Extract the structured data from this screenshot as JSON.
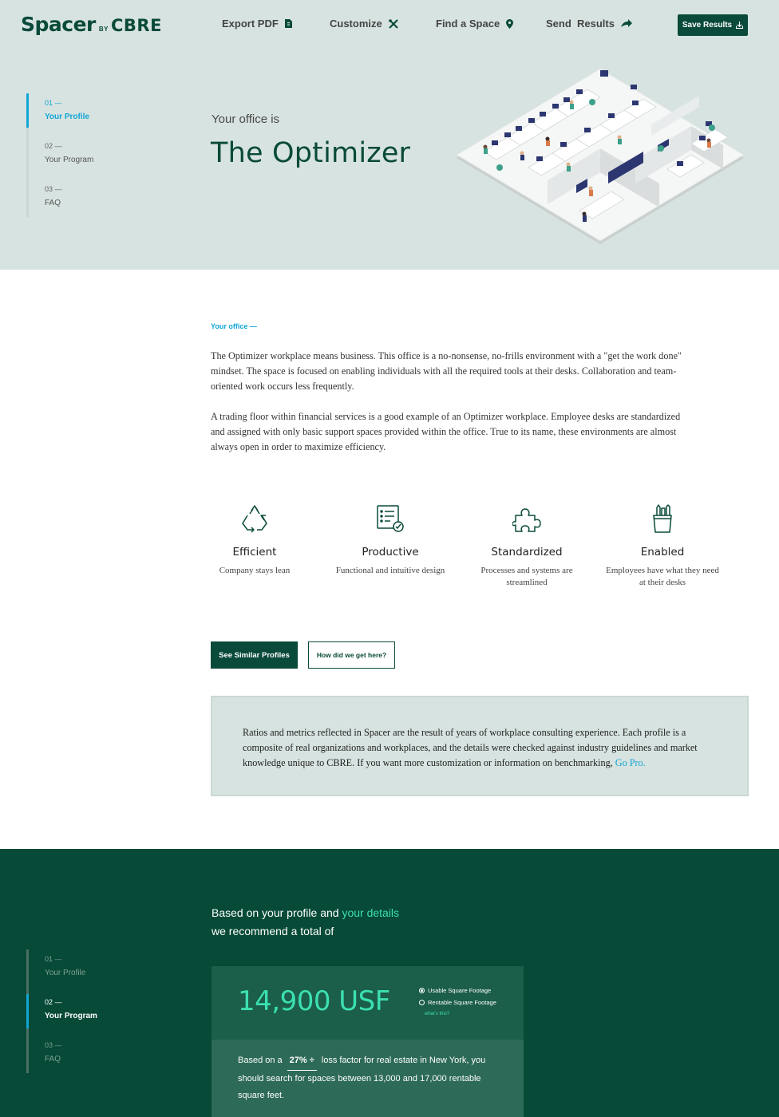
{
  "header": {
    "logo": {
      "spacer": "Spacer",
      "by": "BY",
      "cbre": "CBRE"
    },
    "nav": {
      "export_pdf": "Export PDF",
      "customize": "Customize",
      "find_space": "Find a Space",
      "send_results": "Send  Results"
    },
    "save_results": "Save Results",
    "icons": [
      "pdf-file-icon",
      "tools-icon",
      "map-pin-icon",
      "arrow-share-icon",
      "download-icon"
    ]
  },
  "steps": [
    {
      "num": "01 —",
      "label": "Your Profile"
    },
    {
      "num": "02 —",
      "label": "Your Program"
    },
    {
      "num": "03 —",
      "label": "FAQ"
    }
  ],
  "hero": {
    "kicker": "Your office is",
    "title": "The Optimizer"
  },
  "content": {
    "section_label": "Your office —",
    "paragraph_1": "The Optimizer workplace means business. This office is a no-nonsense, no-frills environment with a \"get the work done\" mindset. The space is focused on enabling individuals with all the required tools at their desks. Collaboration and team-oriented work occurs less frequently.",
    "paragraph_2": "A trading floor within financial services is a good example of an Optimizer workplace. Employee desks are standardized and assigned with only basic support spaces provided within the office. True to its name, these environments are almost always open in order to maximize efficiency."
  },
  "features": [
    {
      "icon": "recycle-icon",
      "title": "Efficient",
      "desc": "Company stays lean"
    },
    {
      "icon": "checklist-icon",
      "title": "Productive",
      "desc": "Functional and intuitive design"
    },
    {
      "icon": "puzzle-icon",
      "title": "Standardized",
      "desc": "Processes and systems are streamlined"
    },
    {
      "icon": "pencil-cup-icon",
      "title": "Enabled",
      "desc": "Employees have what they need at their desks"
    }
  ],
  "buttons": {
    "similar_profiles": "See Similar Profiles",
    "how_did_we": "How did we get here?"
  },
  "note": {
    "text": "Ratios and metrics reflected in Spacer are the result of years of workplace consulting experience. Each profile is a composite of real organizations and workplaces, and the details were checked against industry guidelines and market knowledge unique to CBRE. If you want more customization or information on benchmarking,",
    "link": "Go Pro."
  },
  "recommendation": {
    "line1_prefix": "Based on your profile and",
    "line1_link": "your details",
    "line2": "we recommend a total of",
    "value": "14,900 USF",
    "options": [
      "Usable Square Footage",
      "Rentable Square Footage"
    ],
    "selected_option": "Usable Square Footage",
    "whats_this": "what's this?",
    "detail_prefix": "Based on a",
    "loss_factor": "27% ÷",
    "detail_suffix": "loss factor for real estate in New York, you should search for spaces between 13,000 and 17,000 rentable square feet."
  },
  "colors": {
    "brand_dark": "#0a4a3a",
    "hero_bg": "#d7e3e0",
    "accent_blue": "#11a6d6",
    "accent_green": "#3ce0b0",
    "dark_section": "#064a37"
  }
}
